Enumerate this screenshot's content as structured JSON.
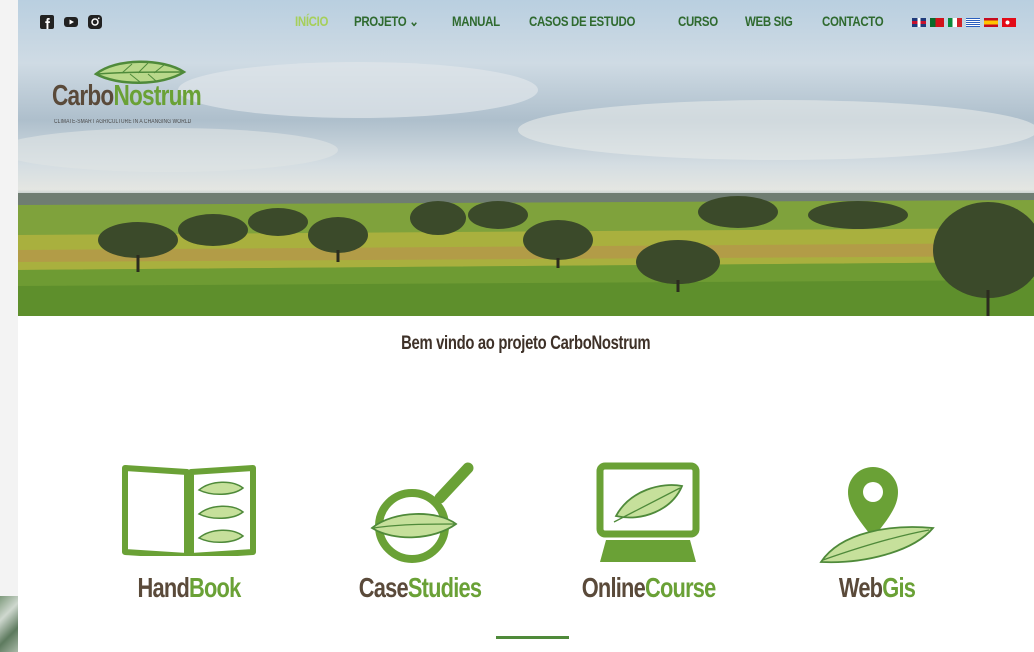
{
  "nav": {
    "items": [
      {
        "label": "INÍCIO",
        "active": true
      },
      {
        "label": "PROJETO",
        "dropdown": true
      },
      {
        "label": "MANUAL"
      },
      {
        "label": "CASOS DE ESTUDO"
      },
      {
        "label": "CURSO"
      },
      {
        "label": "WEB SIG"
      },
      {
        "label": "CONTACTO"
      }
    ],
    "active_color": "#a6cf5a",
    "color": "#2f6a2f"
  },
  "social": [
    "facebook-icon",
    "youtube-icon",
    "instagram-icon"
  ],
  "languages": [
    "en",
    "pt",
    "it",
    "gr",
    "es",
    "tr"
  ],
  "logo": {
    "word_part1": "Carbo",
    "word_part2": "Nostrum",
    "tagline": "CLIMATE-SMART AGRICULTURE IN A CHANGING WORLD"
  },
  "welcome": "Bem vindo ao projeto CarboNostrum",
  "cards": [
    {
      "part1": "Hand",
      "part2": "Book",
      "icon": "handbook-icon"
    },
    {
      "part1": "Case",
      "part2": "Studies",
      "icon": "case-studies-icon"
    },
    {
      "part1": "Online",
      "part2": "Course",
      "icon": "online-course-icon"
    },
    {
      "part1": "Web",
      "part2": "Gis",
      "icon": "webgis-icon"
    }
  ],
  "colors": {
    "green": "#6aa136",
    "dark_green": "#4f8a3a",
    "brown": "#5a4a3a"
  }
}
